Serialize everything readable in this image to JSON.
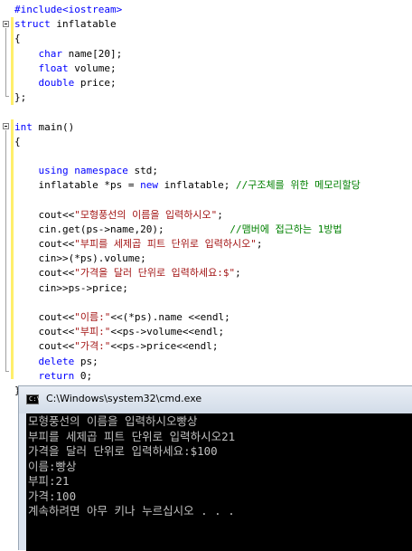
{
  "editor": {
    "lines": [
      [
        {
          "t": "#include<iostream>",
          "c": "pp"
        }
      ],
      [
        {
          "t": "struct",
          "c": "kw"
        },
        {
          "t": " inflatable",
          "c": ""
        }
      ],
      [
        {
          "t": "{",
          "c": ""
        }
      ],
      [
        {
          "t": "    ",
          "c": ""
        },
        {
          "t": "char",
          "c": "kw"
        },
        {
          "t": " name[20];",
          "c": ""
        }
      ],
      [
        {
          "t": "    ",
          "c": ""
        },
        {
          "t": "float",
          "c": "kw"
        },
        {
          "t": " volume;",
          "c": ""
        }
      ],
      [
        {
          "t": "    ",
          "c": ""
        },
        {
          "t": "double",
          "c": "kw"
        },
        {
          "t": " price;",
          "c": ""
        }
      ],
      [
        {
          "t": "};",
          "c": ""
        }
      ],
      [],
      [
        {
          "t": "int",
          "c": "kw"
        },
        {
          "t": " main()",
          "c": ""
        }
      ],
      [
        {
          "t": "{",
          "c": ""
        }
      ],
      [],
      [
        {
          "t": "    ",
          "c": ""
        },
        {
          "t": "using",
          "c": "kw"
        },
        {
          "t": " ",
          "c": ""
        },
        {
          "t": "namespace",
          "c": "kw"
        },
        {
          "t": " std;",
          "c": ""
        }
      ],
      [
        {
          "t": "    inflatable *ps = ",
          "c": ""
        },
        {
          "t": "new",
          "c": "kw"
        },
        {
          "t": " inflatable; ",
          "c": ""
        },
        {
          "t": "//구조체를 위한 메모리할당",
          "c": "cm"
        }
      ],
      [],
      [
        {
          "t": "    cout<<",
          "c": ""
        },
        {
          "t": "\"모형풍선의 이름을 입력하시오\"",
          "c": "str"
        },
        {
          "t": ";",
          "c": ""
        }
      ],
      [
        {
          "t": "    cin.get(ps->name,20);           ",
          "c": ""
        },
        {
          "t": "//맴버에 접근하는 1방법",
          "c": "cm"
        }
      ],
      [
        {
          "t": "    cout<<",
          "c": ""
        },
        {
          "t": "\"부피를 세제곱 피트 단위로 입력하시오\"",
          "c": "str"
        },
        {
          "t": ";",
          "c": ""
        }
      ],
      [
        {
          "t": "    cin>>(*ps).volume;",
          "c": ""
        }
      ],
      [
        {
          "t": "    cout<<",
          "c": ""
        },
        {
          "t": "\"가격을 달러 단위로 입력하세요:$\"",
          "c": "str"
        },
        {
          "t": ";",
          "c": ""
        }
      ],
      [
        {
          "t": "    cin>>ps->price;",
          "c": ""
        }
      ],
      [],
      [
        {
          "t": "    cout<<",
          "c": ""
        },
        {
          "t": "\"이름:\"",
          "c": "str"
        },
        {
          "t": "<<(*ps).name <<endl;",
          "c": ""
        }
      ],
      [
        {
          "t": "    cout<<",
          "c": ""
        },
        {
          "t": "\"부피:\"",
          "c": "str"
        },
        {
          "t": "<<ps->volume<<endl;",
          "c": ""
        }
      ],
      [
        {
          "t": "    cout<<",
          "c": ""
        },
        {
          "t": "\"가격:\"",
          "c": "str"
        },
        {
          "t": "<<ps->price<<endl;",
          "c": ""
        }
      ],
      [
        {
          "t": "    ",
          "c": ""
        },
        {
          "t": "delete",
          "c": "kw"
        },
        {
          "t": " ps;",
          "c": ""
        }
      ],
      [
        {
          "t": "    ",
          "c": ""
        },
        {
          "t": "return",
          "c": "kw"
        },
        {
          "t": " 0;",
          "c": ""
        }
      ],
      [
        {
          "t": "}",
          "c": ""
        }
      ]
    ]
  },
  "cmd": {
    "title": "C:\\Windows\\system32\\cmd.exe",
    "icon_text": "C:\\",
    "output": [
      "모형풍선의 이름을 입력하시오빵상",
      "부피를 세제곱 피트 단위로 입력하시오21",
      "가격을 달러 단위로 입력하세요:$100",
      "이름:빵상",
      "부피:21",
      "가격:100",
      "계속하려면 아무 키나 누르십시오 . . ."
    ]
  }
}
